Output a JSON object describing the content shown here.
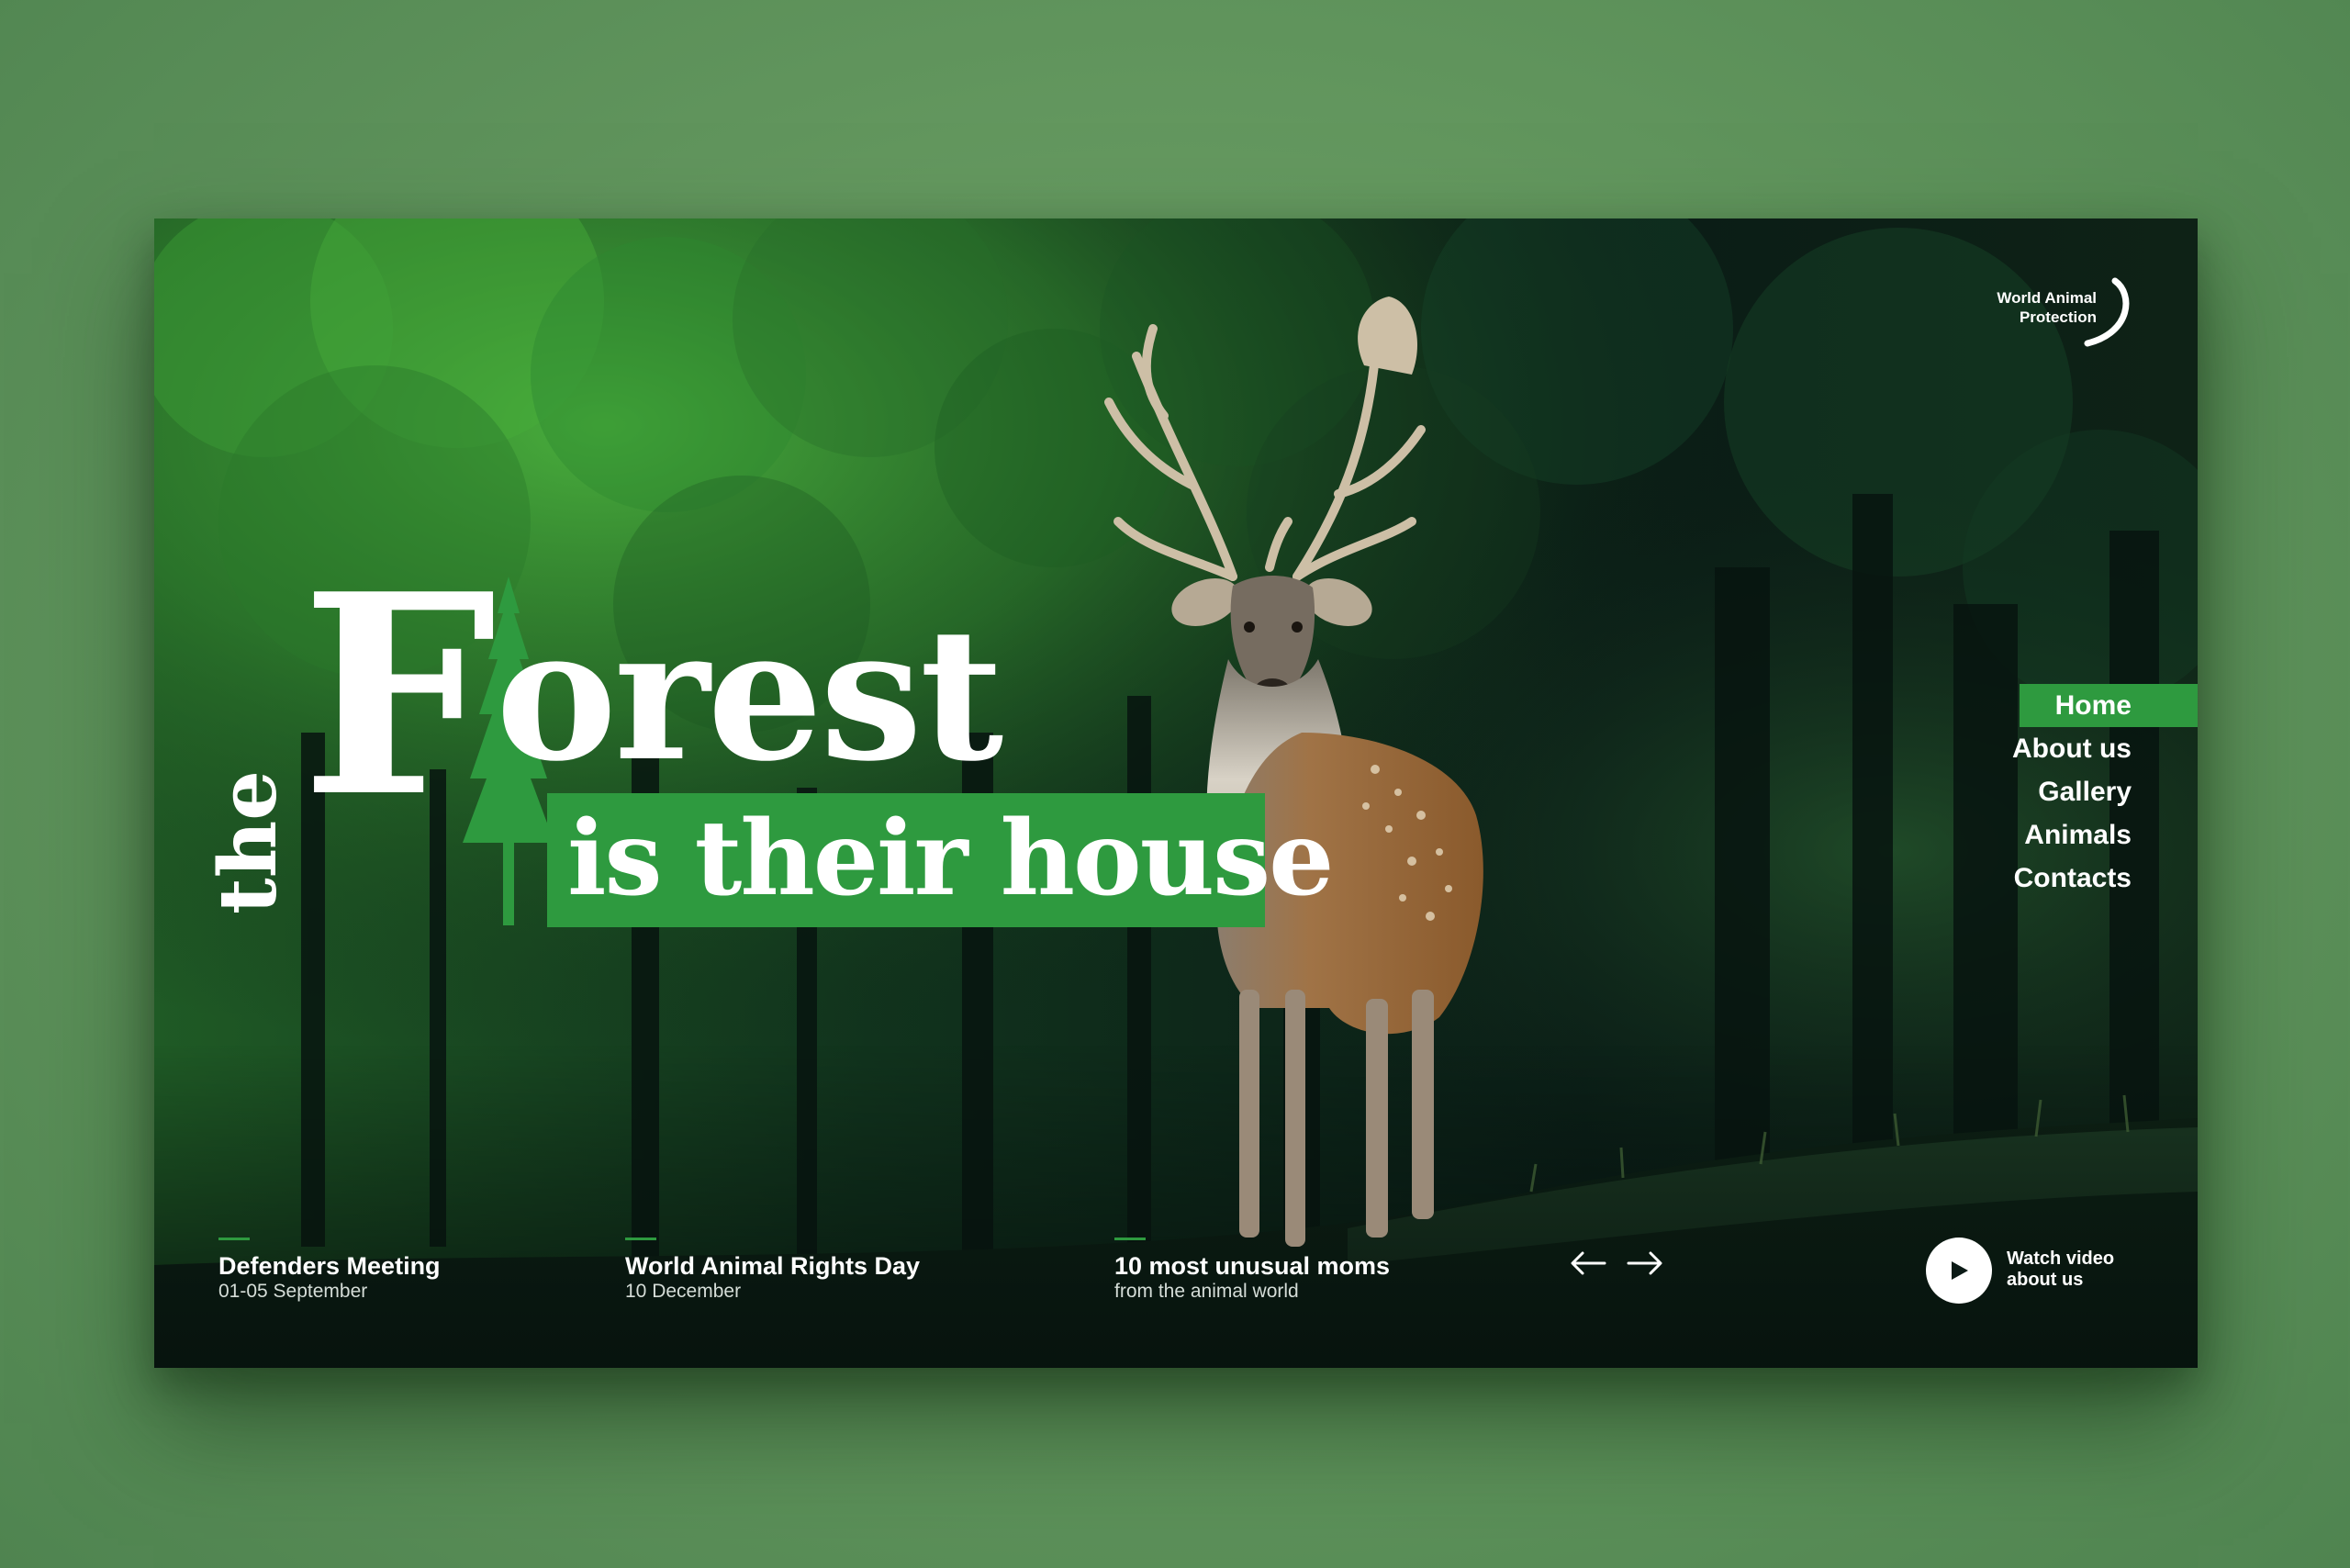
{
  "brand": {
    "line1": "World Animal",
    "line2": "Protection"
  },
  "hero": {
    "word_the": "the",
    "word_F": "F",
    "word_orest": "orest",
    "subtitle": "is their house"
  },
  "nav": {
    "items": [
      {
        "label": "Home",
        "active": true
      },
      {
        "label": "About us",
        "active": false
      },
      {
        "label": "Gallery",
        "active": false
      },
      {
        "label": "Animals",
        "active": false
      },
      {
        "label": "Contacts",
        "active": false
      }
    ]
  },
  "news": [
    {
      "title": "Defenders Meeting",
      "subtitle": "01-05 September"
    },
    {
      "title": "World Animal Rights Day",
      "subtitle": "10 December"
    },
    {
      "title": "10 most unusual moms",
      "subtitle": "from the animal world"
    }
  ],
  "slider": {
    "prev_icon": "arrow-left-icon",
    "next_icon": "arrow-right-icon"
  },
  "video": {
    "line1": "Watch video",
    "line2": "about us",
    "icon": "play-icon"
  },
  "colors": {
    "accent": "#2e9a3f",
    "page_background": "#64985f",
    "text": "#ffffff"
  }
}
